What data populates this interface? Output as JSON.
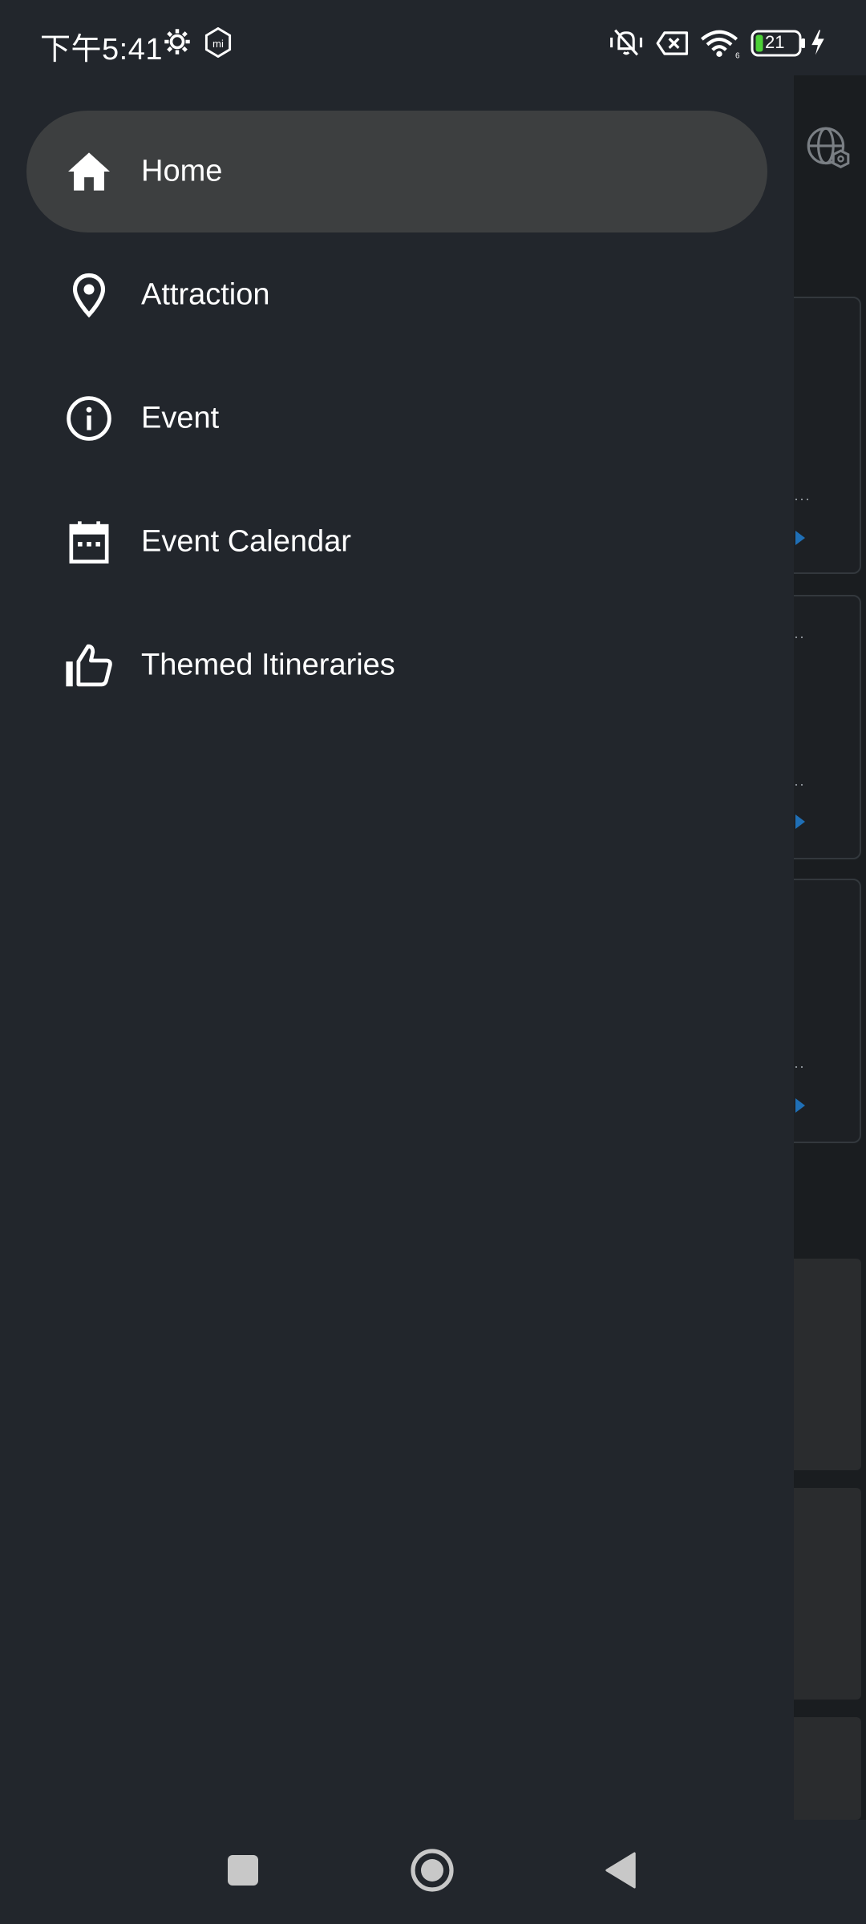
{
  "status_bar": {
    "time": "下午5:41",
    "battery_level": "21",
    "icons": [
      "settings-gear-icon",
      "mi-icon",
      "vibrate-mute-icon",
      "sim-error-icon",
      "wifi-icon",
      "battery-icon",
      "charging-icon"
    ]
  },
  "drawer": {
    "items": [
      {
        "label": "Home",
        "icon": "home-icon",
        "active": true
      },
      {
        "label": "Attraction",
        "icon": "location-pin-icon",
        "active": false
      },
      {
        "label": "Event",
        "icon": "info-icon",
        "active": false
      },
      {
        "label": "Event Calendar",
        "icon": "calendar-icon",
        "active": false
      },
      {
        "label": "Themed Itineraries",
        "icon": "thumbs-up-icon",
        "active": false
      }
    ]
  },
  "background_app": {
    "header_icon": "globe-settings-icon"
  },
  "system_nav": {
    "buttons": [
      "recents-button",
      "home-button",
      "back-button"
    ]
  },
  "colors": {
    "background": "#22262c",
    "active_item": "#3d3f40",
    "text": "#ffffff",
    "accent": "#1f6fb6"
  }
}
